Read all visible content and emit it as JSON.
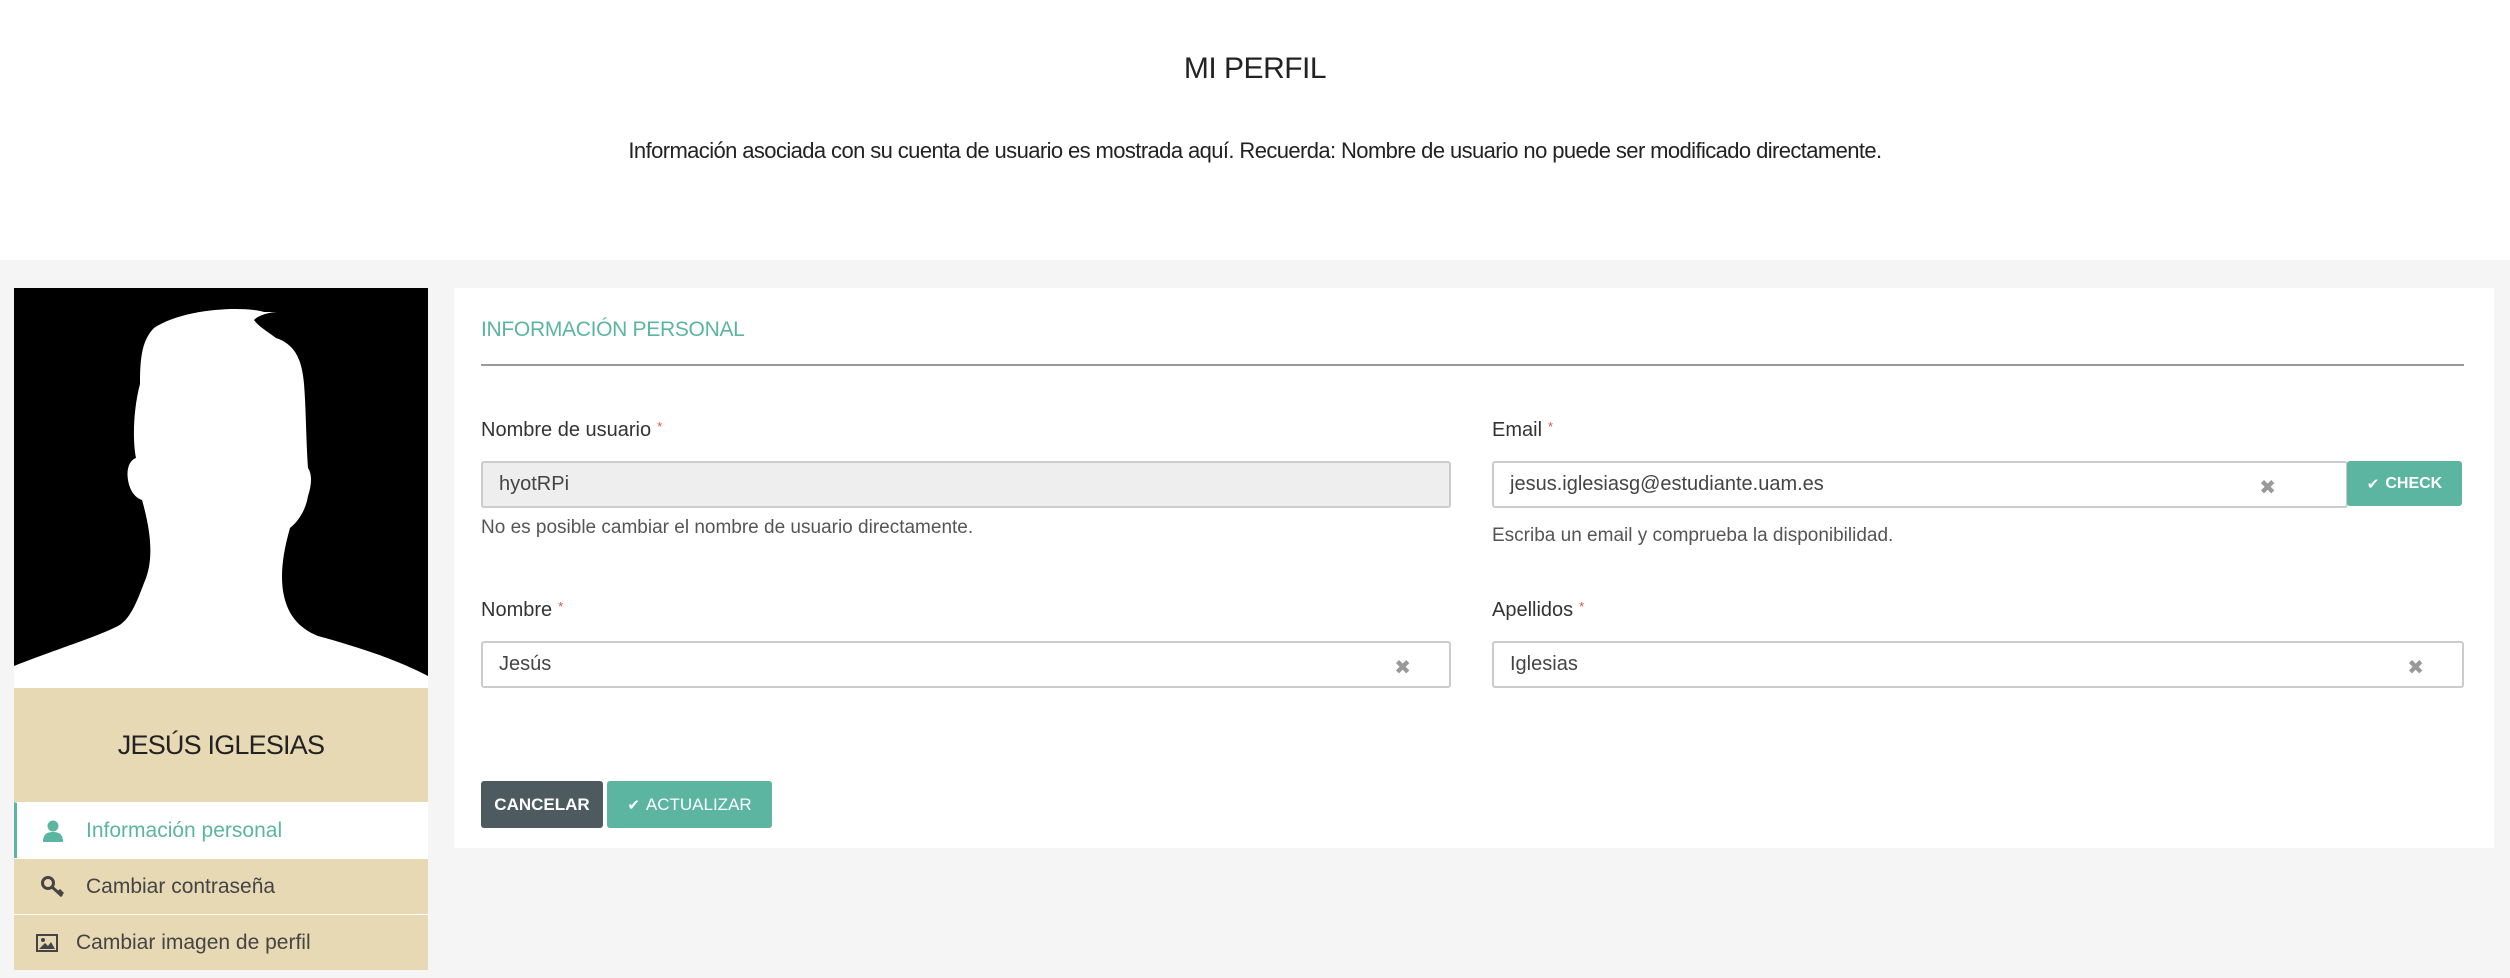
{
  "header": {
    "title": "MI PERFIL",
    "subtitle": "Información asociada con su cuenta de usuario es mostrada aquí. Recuerda: Nombre de usuario no puede ser modificado directamente."
  },
  "profile": {
    "name": "JESÚS IGLESIAS"
  },
  "sidebar": {
    "items": [
      {
        "label": "Información personal",
        "icon": "user-icon",
        "active": true
      },
      {
        "label": "Cambiar contraseña",
        "icon": "key-icon",
        "active": false
      },
      {
        "label": "Cambiar imagen de perfil",
        "icon": "image-icon",
        "active": false
      }
    ]
  },
  "form": {
    "section_title": "INFORMACIÓN PERSONAL",
    "required_mark": "*",
    "username": {
      "label": "Nombre de usuario",
      "value": "hyotRPi",
      "help": "No es posible cambiar el nombre de usuario directamente."
    },
    "email": {
      "label": "Email",
      "value": "jesus.iglesiasg@estudiante.uam.es",
      "help": "Escriba un email y comprueba la disponibilidad.",
      "check_label": "CHECK"
    },
    "nombre": {
      "label": "Nombre",
      "value": "Jesús"
    },
    "apellidos": {
      "label": "Apellidos",
      "value": "Iglesias"
    },
    "clear_glyph": "✖",
    "cancel_label": "CANCELAR",
    "update_label": "ACTUALIZAR"
  },
  "colors": {
    "accent": "#5bb5a0",
    "sidebar_bg": "#e8d9b5",
    "cancel_bg": "#4d5a5f",
    "required": "#d9534f"
  }
}
